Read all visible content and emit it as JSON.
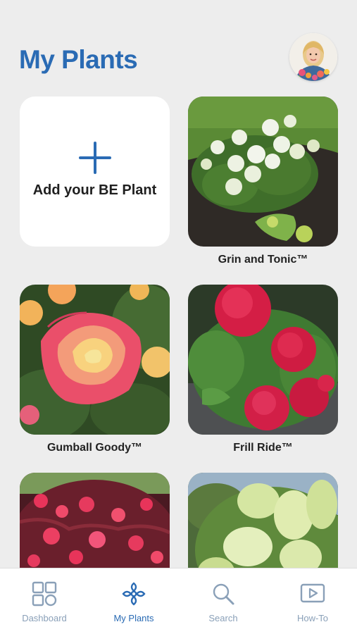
{
  "header": {
    "title": "My Plants",
    "avatar_icon": "user-avatar-photo"
  },
  "add_card": {
    "label": "Add your BE Plant",
    "icon": "plus-icon"
  },
  "plants": [
    {
      "name": "Grin and Tonic™"
    },
    {
      "name": "Gumball Goody™"
    },
    {
      "name": "Frill Ride™"
    },
    {
      "name": ""
    },
    {
      "name": ""
    }
  ],
  "tabbar": {
    "tabs": [
      {
        "label": "Dashboard",
        "icon": "dashboard-grid-icon",
        "active": false
      },
      {
        "label": "My Plants",
        "icon": "flower-icon",
        "active": true
      },
      {
        "label": "Search",
        "icon": "search-icon",
        "active": false
      },
      {
        "label": "How-To",
        "icon": "play-video-icon",
        "active": false
      }
    ]
  },
  "colors": {
    "brand_blue": "#2a6bb4",
    "inactive_tab": "#8aa0b8",
    "background": "#ededed",
    "card": "#ffffff"
  }
}
